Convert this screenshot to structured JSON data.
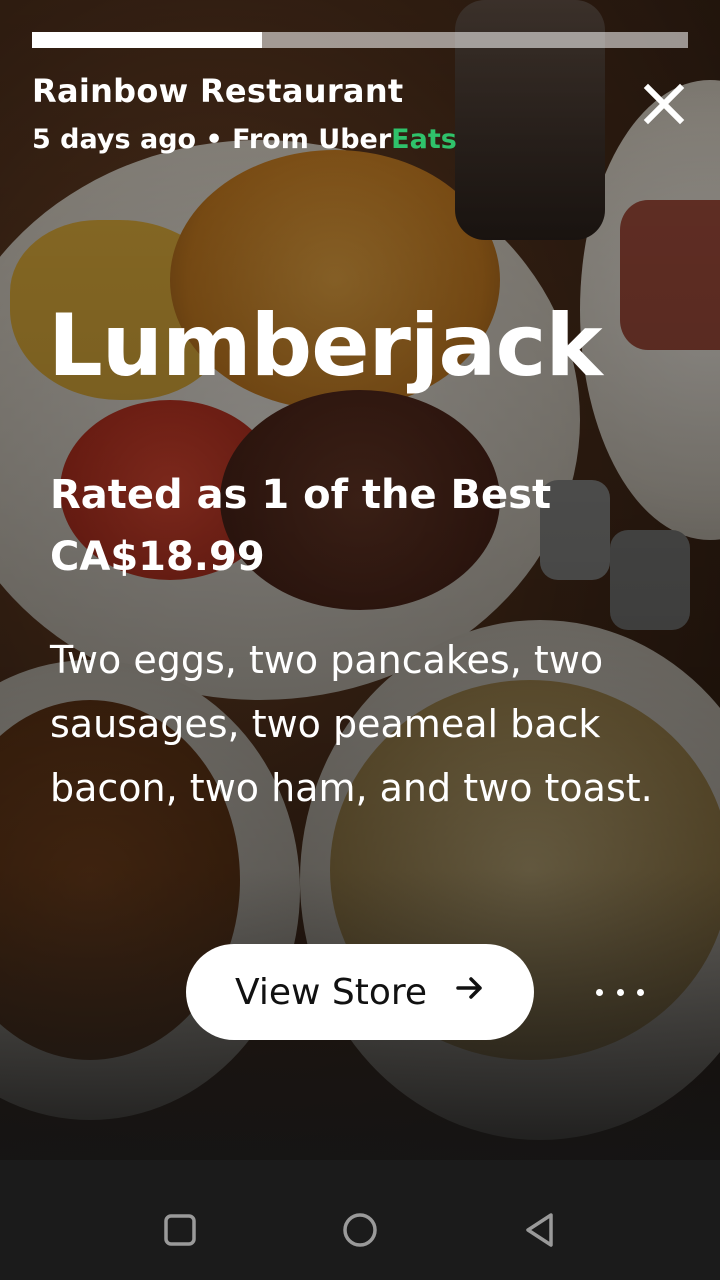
{
  "story": {
    "progress": 0.35,
    "restaurant_name": "Rainbow Restaurant",
    "time_ago": "5 days ago",
    "separator": " • ",
    "from_label": "From ",
    "brand_uber": "Uber",
    "brand_eats": "Eats",
    "brand_eats_color": "#2fc26b",
    "close_icon": "close-icon"
  },
  "item": {
    "name": "Lumberjack",
    "rating_text": "Rated as 1 of the Best",
    "price": "CA$18.99",
    "description": "Two eggs, two pancakes, two sausages, two peameal back bacon, two ham, and two toast."
  },
  "actions": {
    "view_store_label": "View Store",
    "view_store_icon": "arrow-right-icon",
    "more_icon": "more-options-icon"
  },
  "system_nav": {
    "recents_icon": "square-recents-icon",
    "home_icon": "circle-home-icon",
    "back_icon": "triangle-back-icon"
  }
}
